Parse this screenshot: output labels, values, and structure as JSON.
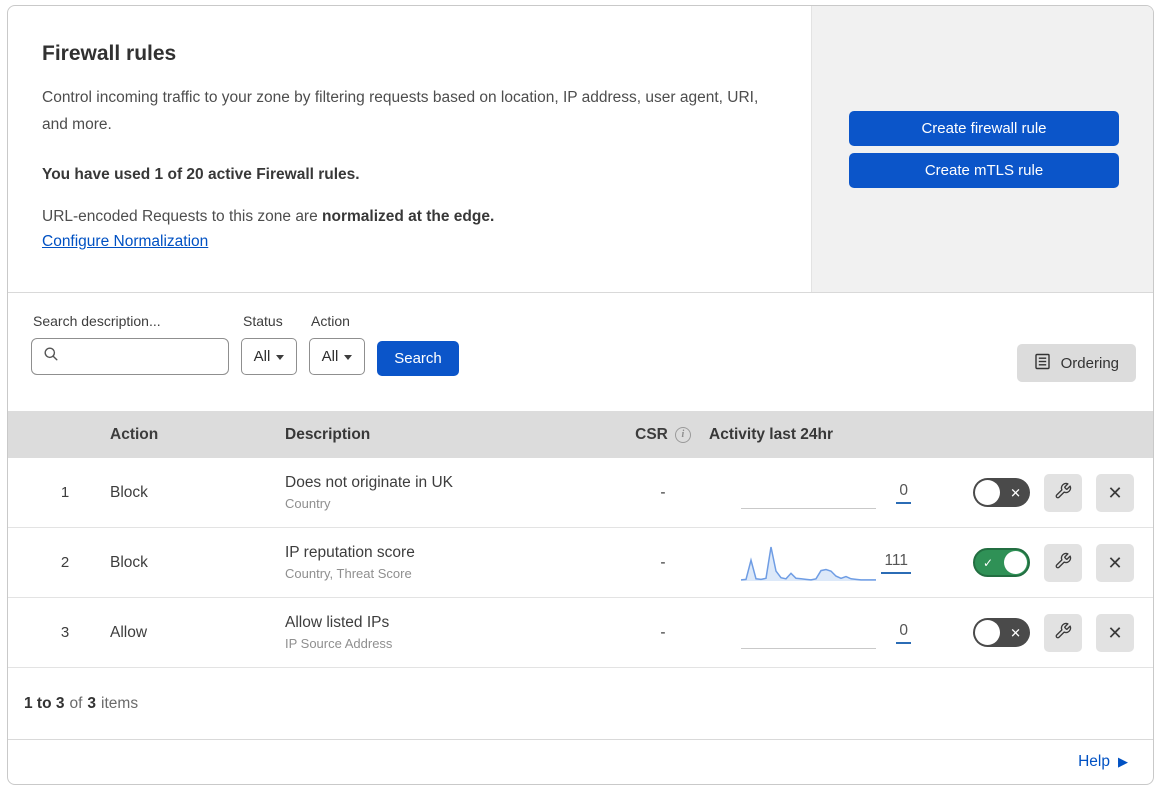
{
  "colors": {
    "primary_blue": "#0b55c9",
    "link_blue": "#0051c3",
    "toggle_on_green": "#2f9156",
    "toggle_off_gray": "#4a4a4a",
    "sparkline_blue": "#6f9de4",
    "sparkline_fill": "#dde9f9",
    "table_header_gray": "#dcdcdc",
    "panel_gray": "#f1f1f1"
  },
  "icons": {
    "check": "✓",
    "cross": "✕",
    "info": "i",
    "help_arrow": "▶"
  },
  "hero": {
    "title": "Firewall rules",
    "description": "Control incoming traffic to your zone by filtering requests based on location, IP address, user agent, URI, and more.",
    "usage": "You have used 1 of 20 active Firewall rules.",
    "normalization_prefix": "URL-encoded Requests to this zone are ",
    "normalization_bold": "normalized at the edge.",
    "configure_link": "Configure Normalization"
  },
  "actions_panel": {
    "create_firewall": "Create firewall rule",
    "create_mtls": "Create mTLS rule"
  },
  "filters": {
    "search_label": "Search description...",
    "status_label": "Status",
    "status_value": "All",
    "action_label": "Action",
    "action_value": "All",
    "search_button": "Search",
    "ordering_button": "Ordering"
  },
  "table": {
    "headers": {
      "action": "Action",
      "description": "Description",
      "csr": "CSR",
      "activity": "Activity last 24hr"
    },
    "rows": [
      {
        "number": "1",
        "action": "Block",
        "description": "Does not originate in UK",
        "criteria": "Country",
        "csr": "-",
        "activity_count": "0",
        "enabled": false
      },
      {
        "number": "2",
        "action": "Block",
        "description": "IP reputation score",
        "criteria": "Country, Threat Score",
        "csr": "-",
        "activity_count": "111",
        "enabled": true,
        "sparkline": [
          2,
          3,
          38,
          4,
          3,
          5,
          62,
          18,
          6,
          4,
          14,
          5,
          4,
          3,
          2,
          4,
          19,
          21,
          18,
          9,
          5,
          8,
          4,
          3,
          2,
          2,
          2,
          2
        ]
      },
      {
        "number": "3",
        "action": "Allow",
        "description": "Allow listed IPs",
        "criteria": "IP Source Address",
        "csr": "-",
        "activity_count": "0",
        "enabled": false
      }
    ]
  },
  "footer": {
    "range": "1 to 3",
    "of": "of",
    "total": "3",
    "items": "items"
  },
  "help": {
    "label": "Help"
  }
}
